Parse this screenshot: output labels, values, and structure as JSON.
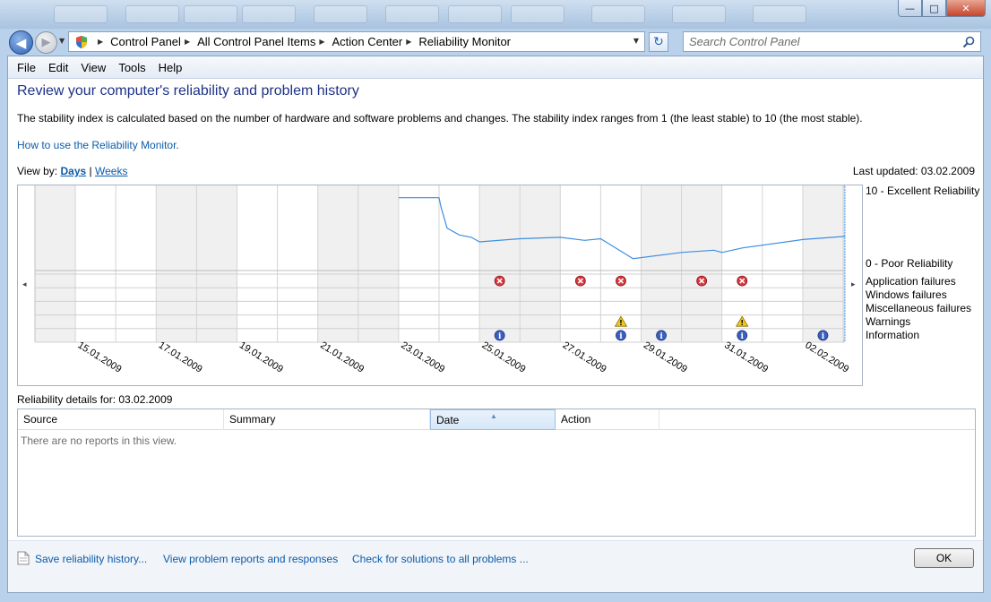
{
  "address": {
    "crumbs": [
      "Control Panel",
      "All Control Panel Items",
      "Action Center",
      "Reliability Monitor"
    ],
    "search_placeholder": "Search Control Panel"
  },
  "menu": [
    "File",
    "Edit",
    "View",
    "Tools",
    "Help"
  ],
  "page": {
    "title": "Review your computer's reliability and problem history",
    "description": "The stability index is calculated based on the number of hardware and software problems and changes. The stability index ranges from 1 (the least stable) to 10 (the most stable).",
    "howto_link": "How to use the Reliability Monitor.",
    "view_by_label": "View by:",
    "view_days": "Days",
    "view_sep": "|",
    "view_weeks": "Weeks",
    "last_updated": "Last updated: 03.02.2009"
  },
  "legend": {
    "top": "10 - Excellent Reliability",
    "bottom": "0 - Poor Reliability",
    "rows": [
      "Application failures",
      "Windows failures",
      "Miscellaneous failures",
      "Warnings",
      "Information"
    ]
  },
  "chart_data": {
    "type": "line",
    "y_range": [
      0,
      10
    ],
    "columns": [
      "14.01",
      "15.01",
      "16.01",
      "17.01",
      "18.01",
      "19.01",
      "20.01",
      "21.01",
      "22.01",
      "23.01",
      "24.01",
      "25.01",
      "26.01",
      "27.01",
      "28.01",
      "29.01",
      "30.01",
      "31.01",
      "01.02",
      "02.02"
    ],
    "date_labels": [
      "15.01.2009",
      "17.01.2009",
      "19.01.2009",
      "21.01.2009",
      "23.01.2009",
      "25.01.2009",
      "27.01.2009",
      "29.01.2009",
      "31.01.2009",
      "02.02.2009"
    ],
    "stability": [
      {
        "day": 9.0,
        "index": 9.1
      },
      {
        "day": 10.0,
        "index": 9.1
      },
      {
        "day": 10.05,
        "index": 7.8
      },
      {
        "day": 10.2,
        "index": 5.1
      },
      {
        "day": 10.5,
        "index": 4.2
      },
      {
        "day": 10.8,
        "index": 3.9
      },
      {
        "day": 11.0,
        "index": 3.3
      },
      {
        "day": 12.0,
        "index": 3.7
      },
      {
        "day": 13.0,
        "index": 3.9
      },
      {
        "day": 13.6,
        "index": 3.5
      },
      {
        "day": 14.0,
        "index": 3.7
      },
      {
        "day": 14.4,
        "index": 2.4
      },
      {
        "day": 14.8,
        "index": 1.1
      },
      {
        "day": 16.0,
        "index": 1.9
      },
      {
        "day": 16.8,
        "index": 2.2
      },
      {
        "day": 17.0,
        "index": 1.9
      },
      {
        "day": 17.5,
        "index": 2.5
      },
      {
        "day": 19.0,
        "index": 3.6
      },
      {
        "day": 20.0,
        "index": 4.0
      }
    ],
    "events": {
      "application_failures": [
        "25.01",
        "27.01",
        "28.01",
        "30.01",
        "31.01"
      ],
      "warnings": [
        "28.01",
        "31.01"
      ],
      "information": [
        "25.01",
        "28.01",
        "29.01",
        "31.01",
        "02.02"
      ]
    },
    "selected_column": "03.02"
  },
  "details": {
    "label": "Reliability details for: 03.02.2009",
    "columns": [
      "Source",
      "Summary",
      "Date",
      "Action"
    ],
    "sorted_column": "Date",
    "empty_text": "There are no reports in this view."
  },
  "footer": {
    "save_link": "Save reliability history...",
    "view_link": "View problem reports and responses",
    "check_link": "Check for solutions to all problems ...",
    "ok": "OK"
  },
  "colors": {
    "line": "#3d8fe0",
    "selected": "#cce3fb",
    "alt_col": "#f0f0f0",
    "error": "#d9363e",
    "warning": "#f2c81e",
    "info": "#3a5fc2"
  }
}
